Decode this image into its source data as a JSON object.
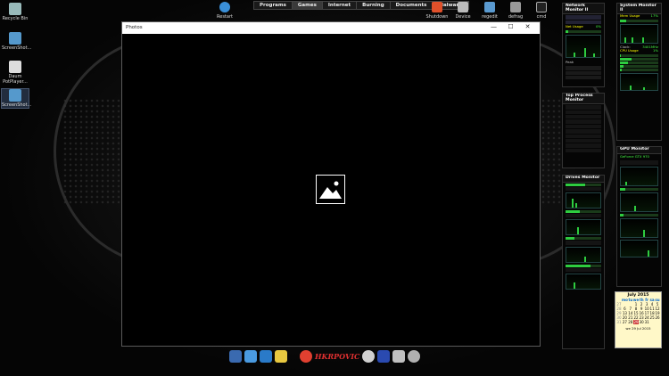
{
  "desktop_icons": [
    {
      "label": "Recycle Bin",
      "color": "#9bb"
    },
    {
      "label": "ScreenShot...",
      "color": "#59c"
    },
    {
      "label": "Daum PotPlayer...",
      "color": "#ddd"
    },
    {
      "label": "ScreenShot...",
      "color": "#59c"
    }
  ],
  "topbar": {
    "restart": "Restart",
    "menu": [
      "Programs",
      "Games",
      "Internet",
      "Burning",
      "Documents",
      "Malware"
    ],
    "active_menu": 1,
    "right_icons": [
      "Shutdown",
      "Device",
      "regedit",
      "defrag",
      "cmd"
    ]
  },
  "photos": {
    "title": "Photos",
    "minimize": "—",
    "maximize": "☐",
    "close": "✕"
  },
  "network_monitor": {
    "title": "Network Monitor II",
    "net_usage": "Net Usage",
    "net_usage_val": "0%",
    "peak": "Peak"
  },
  "system_monitor": {
    "title": "System Monitor II",
    "mem_usage": "Mem Usage",
    "mem_val": "17%",
    "clock": "Clock:",
    "clock_val": "3401MHz",
    "cpu_usage": "CPU Usage",
    "cpu_val": "1%"
  },
  "top_process": {
    "title": "Top Process Monitor"
  },
  "gpu_monitor": {
    "title": "GPU Monitor",
    "gpu_name": "GeForce GTX 970"
  },
  "drives_monitor": {
    "title": "Drives Monitor"
  },
  "calendar": {
    "title": "July 2015",
    "days_header": [
      "",
      "mo",
      "tu",
      "we",
      "th",
      "fr",
      "sa",
      "su"
    ],
    "rows": [
      [
        "27",
        "",
        "",
        "1",
        "2",
        "3",
        "4",
        "5"
      ],
      [
        "28",
        "6",
        "7",
        "8",
        "9",
        "10",
        "11",
        "12"
      ],
      [
        "29",
        "13",
        "14",
        "15",
        "16",
        "17",
        "18",
        "19"
      ],
      [
        "30",
        "20",
        "21",
        "22",
        "23",
        "24",
        "25",
        "26"
      ],
      [
        "31",
        "27",
        "28",
        "29",
        "30",
        "31",
        "",
        ""
      ]
    ],
    "footer": "we 29 Jul 2015"
  },
  "dock": {
    "logo": "HKRPOVIC"
  }
}
